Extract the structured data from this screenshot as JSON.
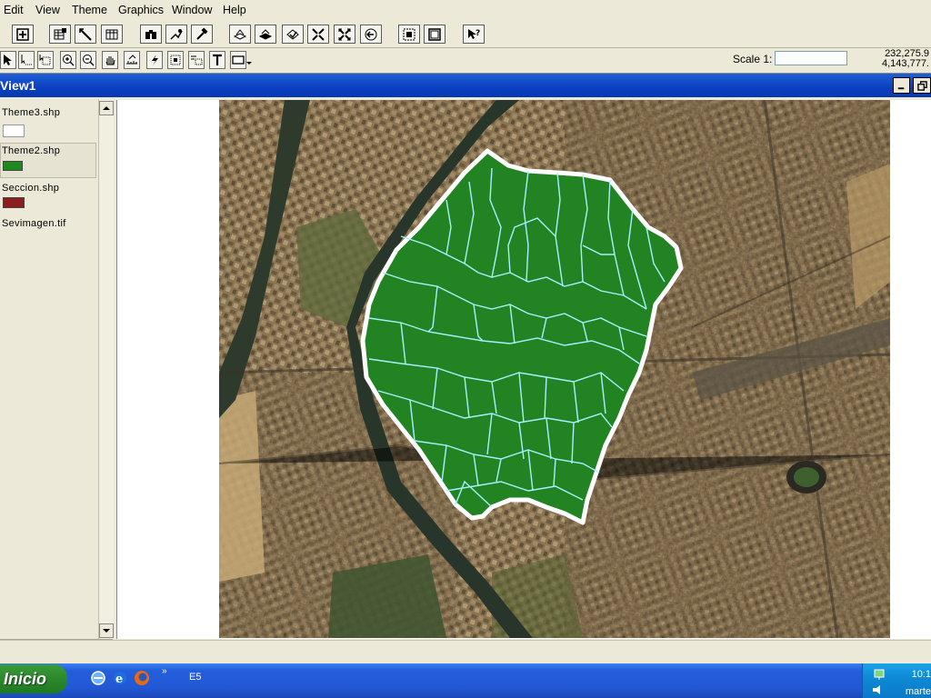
{
  "menu": [
    "Edit",
    "View",
    "Theme",
    "Graphics",
    "Window",
    "Help"
  ],
  "toolbar_icons": [
    "save-icon",
    "table-properties-icon",
    "edit-pencil-icon",
    "table-icon",
    "find-binoculars-icon",
    "locate-address-icon",
    "hammer-query-icon",
    "theme-on-icon",
    "theme-off-icon",
    "select-features-icon",
    "zoom-full-extent-icon",
    "zoom-to-active-icon",
    "zoom-previous-icon",
    "select-all-icon",
    "clear-selection-icon",
    "help-cursor-icon"
  ],
  "tools": [
    "pointer-tool-icon",
    "vertex-edit-tool-icon",
    "identify-tool-icon",
    "zoom-in-tool-icon",
    "zoom-out-tool-icon",
    "pan-hand-tool-icon",
    "measure-tool-icon",
    "hotlink-tool-icon",
    "area-of-interest-tool-icon",
    "label-tool-icon",
    "text-tool-icon",
    "draw-rectangle-tool-icon"
  ],
  "scale": {
    "label": "Scale 1:",
    "value": ""
  },
  "coordinates": {
    "x": "232,275.9",
    "y": "4,143,777."
  },
  "view": {
    "title": "View1"
  },
  "toc": [
    {
      "name": "Theme3.shp",
      "swatch_color": "#ffffff"
    },
    {
      "name": "Theme2.shp",
      "swatch_color": "#1e8a1e"
    },
    {
      "name": "Seccion.shp",
      "swatch_color": "#8b1e1e"
    },
    {
      "name": "Sevimagen.tif",
      "swatch_color": ""
    }
  ],
  "taskbar": {
    "start_label": "Inicio",
    "window_label": "E5",
    "clock": "10:1",
    "day": "marte"
  },
  "colors": {
    "polygon_fill": "#228322",
    "section_lines": "#a8f0ff",
    "outline": "#ffffff",
    "titlebar": "#0a3fc0"
  }
}
